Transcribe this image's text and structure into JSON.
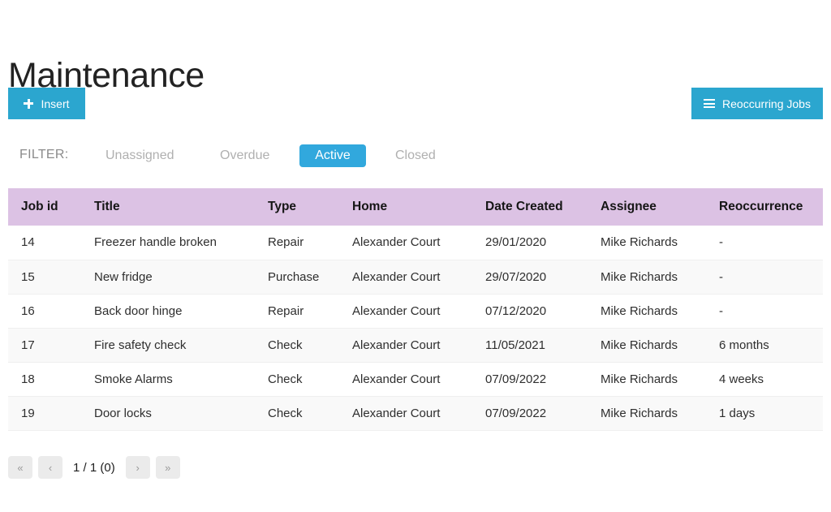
{
  "page_title": "Maintenance",
  "colors": {
    "accent_blue": "#2ba6cf",
    "filter_active_blue": "#31a8dd",
    "table_header_lavender": "#dcc2e4",
    "row_stripe": "#f9f9f9"
  },
  "actions": {
    "insert": {
      "label": "Insert",
      "icon": "plus-icon"
    },
    "reoccurring_jobs": {
      "label": "Reoccurring Jobs",
      "icon": "hamburger-icon"
    }
  },
  "filter": {
    "caption": "FILTER:",
    "options": [
      {
        "label": "Unassigned",
        "active": false
      },
      {
        "label": "Overdue",
        "active": false
      },
      {
        "label": "Active",
        "active": true
      },
      {
        "label": "Closed",
        "active": false
      }
    ]
  },
  "table": {
    "columns": [
      "Job id",
      "Title",
      "Type",
      "Home",
      "Date Created",
      "Assignee",
      "Reoccurrence"
    ],
    "rows": [
      {
        "job_id": "14",
        "title": "Freezer handle broken",
        "type": "Repair",
        "home": "Alexander Court",
        "date_created": "29/01/2020",
        "assignee": "Mike Richards",
        "reoccurrence": "-"
      },
      {
        "job_id": "15",
        "title": "New fridge",
        "type": "Purchase",
        "home": "Alexander Court",
        "date_created": "29/07/2020",
        "assignee": "Mike Richards",
        "reoccurrence": "-"
      },
      {
        "job_id": "16",
        "title": "Back door hinge",
        "type": "Repair",
        "home": "Alexander Court",
        "date_created": "07/12/2020",
        "assignee": "Mike Richards",
        "reoccurrence": "-"
      },
      {
        "job_id": "17",
        "title": "Fire safety check",
        "type": "Check",
        "home": "Alexander Court",
        "date_created": "11/05/2021",
        "assignee": "Mike Richards",
        "reoccurrence": "6 months"
      },
      {
        "job_id": "18",
        "title": "Smoke Alarms",
        "type": "Check",
        "home": "Alexander Court",
        "date_created": "07/09/2022",
        "assignee": "Mike Richards",
        "reoccurrence": "4 weeks"
      },
      {
        "job_id": "19",
        "title": "Door locks",
        "type": "Check",
        "home": "Alexander Court",
        "date_created": "07/09/2022",
        "assignee": "Mike Richards",
        "reoccurrence": "1 days"
      }
    ]
  },
  "pagination": {
    "first_label": "«",
    "prev_label": "‹",
    "status": "1 / 1 (0)",
    "next_label": "›",
    "last_label": "»"
  }
}
